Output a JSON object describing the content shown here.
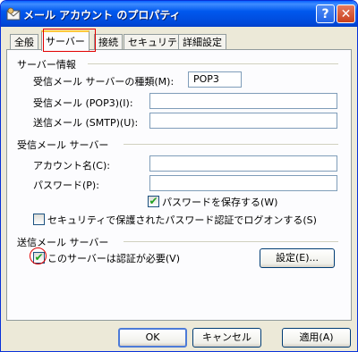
{
  "window": {
    "title": "メール アカウント のプロパティ",
    "help_glyph": "?",
    "close_glyph": "✕"
  },
  "tabs": [
    {
      "label": "全般"
    },
    {
      "label": "サーバー",
      "active": true
    },
    {
      "label": "接続"
    },
    {
      "label": "セキュリティ"
    },
    {
      "label": "詳細設定"
    }
  ],
  "server_info": {
    "group_label": "サーバー情報",
    "incoming_type_label": "受信メール サーバーの種類(M):",
    "incoming_type_value": "POP3",
    "incoming_label": "受信メール (POP3)(I):",
    "incoming_value": "",
    "outgoing_label": "送信メール (SMTP)(U):",
    "outgoing_value": ""
  },
  "incoming_server": {
    "group_label": "受信メール サーバー",
    "account_label": "アカウント名(C):",
    "account_value": "",
    "password_label": "パスワード(P):",
    "password_value": "",
    "save_password_label": "パスワードを保存する(W)",
    "save_password_checked": true,
    "spa_label": "セキュリティで保護されたパスワード認証でログオンする(S)",
    "spa_checked": false
  },
  "outgoing_server": {
    "group_label": "送信メール サーバー",
    "auth_label": "このサーバーは認証が必要(V)",
    "auth_checked": true,
    "settings_button": "設定(E)..."
  },
  "buttons": {
    "ok": "OK",
    "cancel": "キャンセル",
    "apply": "適用(A)"
  },
  "check_glyph": "✔"
}
